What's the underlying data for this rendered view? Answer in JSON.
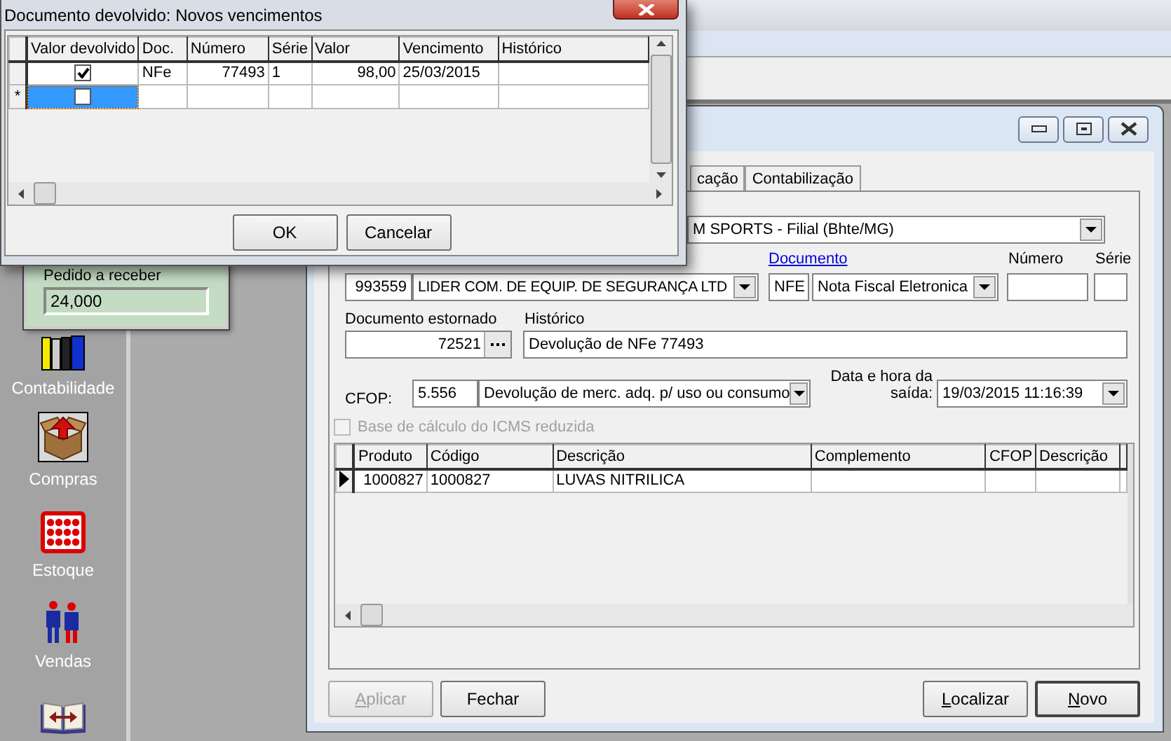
{
  "dialog": {
    "title": "Documento devolvido: Novos vencimentos",
    "columns": [
      "Valor devolvido",
      "Doc.",
      "Número",
      "Série",
      "Valor",
      "Vencimento",
      "Histórico"
    ],
    "rows": [
      {
        "indicator": "",
        "returned_value_checked": true,
        "doc": "NFe",
        "numero": "77493",
        "serie": "1",
        "valor": "98,00",
        "vencimento": "25/03/2015",
        "selected": false
      },
      {
        "indicator": "*",
        "returned_value_checked": false,
        "selected": true
      }
    ],
    "buttons": [
      {
        "label": "OK"
      },
      {
        "label": "Cancelar"
      }
    ]
  },
  "sidebar": {
    "panel": {
      "label": "Pedido a receber",
      "value": "24,000"
    },
    "items": [
      {
        "kind": "binders",
        "label": "Contabilidade"
      },
      {
        "kind": "box",
        "label": "Compras"
      },
      {
        "kind": "abacus",
        "label": "Estoque"
      },
      {
        "kind": "people",
        "label": "Vendas"
      },
      {
        "kind": "book"
      }
    ]
  },
  "main_window": {
    "tabs": [
      {
        "label": "cação",
        "selected": false
      },
      {
        "label": "Contabilização",
        "selected": false
      }
    ],
    "filial": "M SPORTS - Filial (Bhte/MG)",
    "supplier_code": "993559",
    "supplier_name": "LIDER COM. DE EQUIP. DE SEGURANÇA LTD",
    "documento_link": "Documento",
    "numero_label": "Número",
    "serie_label": "Série",
    "doc_type_code": "NFE",
    "doc_type_name": "Nota Fiscal Eletronica",
    "documento_estornado": {
      "label": "Documento estornado",
      "value": "72521"
    },
    "historico": {
      "label": "Histórico",
      "value": "Devolução de NFe 77493"
    },
    "cfop": {
      "label": "CFOP:",
      "code": "5.556",
      "description": "Devolução de merc. adq. p/ uso ou consumo"
    },
    "data_saida": {
      "label": "Data e hora da saída:",
      "value": "19/03/2015 11:16:39"
    },
    "icms_reduzida": {
      "label": "Base de cálculo do ICMS reduzida",
      "checked": false,
      "disabled": true
    },
    "grid": {
      "columns": [
        "Produto",
        "Código",
        "Descrição",
        "Complemento",
        "CFOP",
        "Descrição"
      ],
      "rows": [
        {
          "produto": "1000827",
          "codigo": "1000827",
          "descricao": "LUVAS NITRILICA",
          "current": true
        }
      ]
    },
    "buttons_left": [
      {
        "label": "Aplicar",
        "disabled": true,
        "mnemonic_first": true,
        "default": false
      },
      {
        "label": "Fechar",
        "disabled": false,
        "mnemonic_first": false,
        "default": false
      }
    ],
    "buttons_right": [
      {
        "label": "Localizar",
        "disabled": false,
        "mnemonic_first": true,
        "default": false
      },
      {
        "label": "Novo",
        "disabled": false,
        "mnemonic_first": true,
        "default": true
      }
    ]
  }
}
